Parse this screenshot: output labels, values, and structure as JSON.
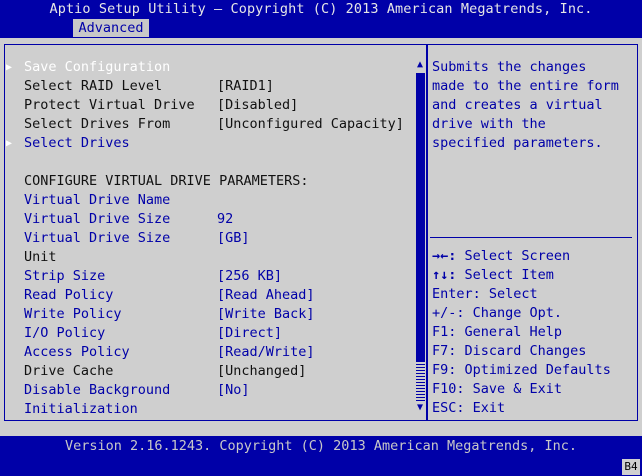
{
  "header": {
    "title": "Aptio Setup Utility – Copyright (C) 2013 American Megatrends, Inc.",
    "tab_active": "Advanced"
  },
  "main": {
    "items": [
      {
        "label": "Save Configuration",
        "value": "",
        "selected": true,
        "submenu": true
      },
      {
        "label": "Select RAID Level",
        "value": "[RAID1]"
      },
      {
        "label": "Protect Virtual Drive",
        "value": "[Disabled]"
      },
      {
        "label": "Select Drives From",
        "value": "[Unconfigured Capacity]"
      },
      {
        "label": "Select Drives",
        "value": "",
        "submenu": true
      },
      {
        "label": "",
        "value": ""
      },
      {
        "label": "CONFIGURE VIRTUAL DRIVE PARAMETERS:",
        "value": ""
      },
      {
        "label": "Virtual Drive Name",
        "value": ""
      },
      {
        "label": "Virtual Drive Size",
        "value": "92"
      },
      {
        "label": "Virtual Drive Size",
        "value": "[GB]"
      },
      {
        "label": "Unit",
        "value": ""
      },
      {
        "label": "Strip Size",
        "value": "[256 KB]"
      },
      {
        "label": "Read Policy",
        "value": "[Read Ahead]"
      },
      {
        "label": "Write Policy",
        "value": "[Write Back]"
      },
      {
        "label": "I/O Policy",
        "value": "[Direct]"
      },
      {
        "label": "Access Policy",
        "value": "[Read/Write]"
      },
      {
        "label": "Drive Cache",
        "value": "[Unchanged]"
      },
      {
        "label": "Disable Background",
        "value": "[No]"
      },
      {
        "label": "Initialization",
        "value": ""
      }
    ],
    "scroll_up": "▲",
    "scroll_down": "▼"
  },
  "help": {
    "lines": [
      "Submits the changes",
      "made to the entire form",
      "and creates a virtual",
      "drive with the",
      "specified parameters."
    ]
  },
  "keys": [
    {
      "key": "→←:",
      "desc": " Select Screen"
    },
    {
      "key": "↑↓:",
      "desc": " Select Item"
    },
    {
      "key": "Enter:",
      "desc": " Select"
    },
    {
      "key": "+/-:",
      "desc": " Change Opt."
    },
    {
      "key": "F1:",
      "desc": " General Help"
    },
    {
      "key": "F7:",
      "desc": " Discard Changes"
    },
    {
      "key": "F9:",
      "desc": " Optimized Defaults"
    },
    {
      "key": "F10:",
      "desc": " Save & Exit"
    },
    {
      "key": "ESC:",
      "desc": " Exit"
    }
  ],
  "footer": {
    "version": "Version 2.16.1243. Copyright (C) 2013 American Megatrends, Inc.",
    "badge": "B4"
  },
  "colors": {
    "bios_blue": "#0000a8",
    "panel_gray": "#cfcfcf",
    "highlight": "#ffffff"
  }
}
